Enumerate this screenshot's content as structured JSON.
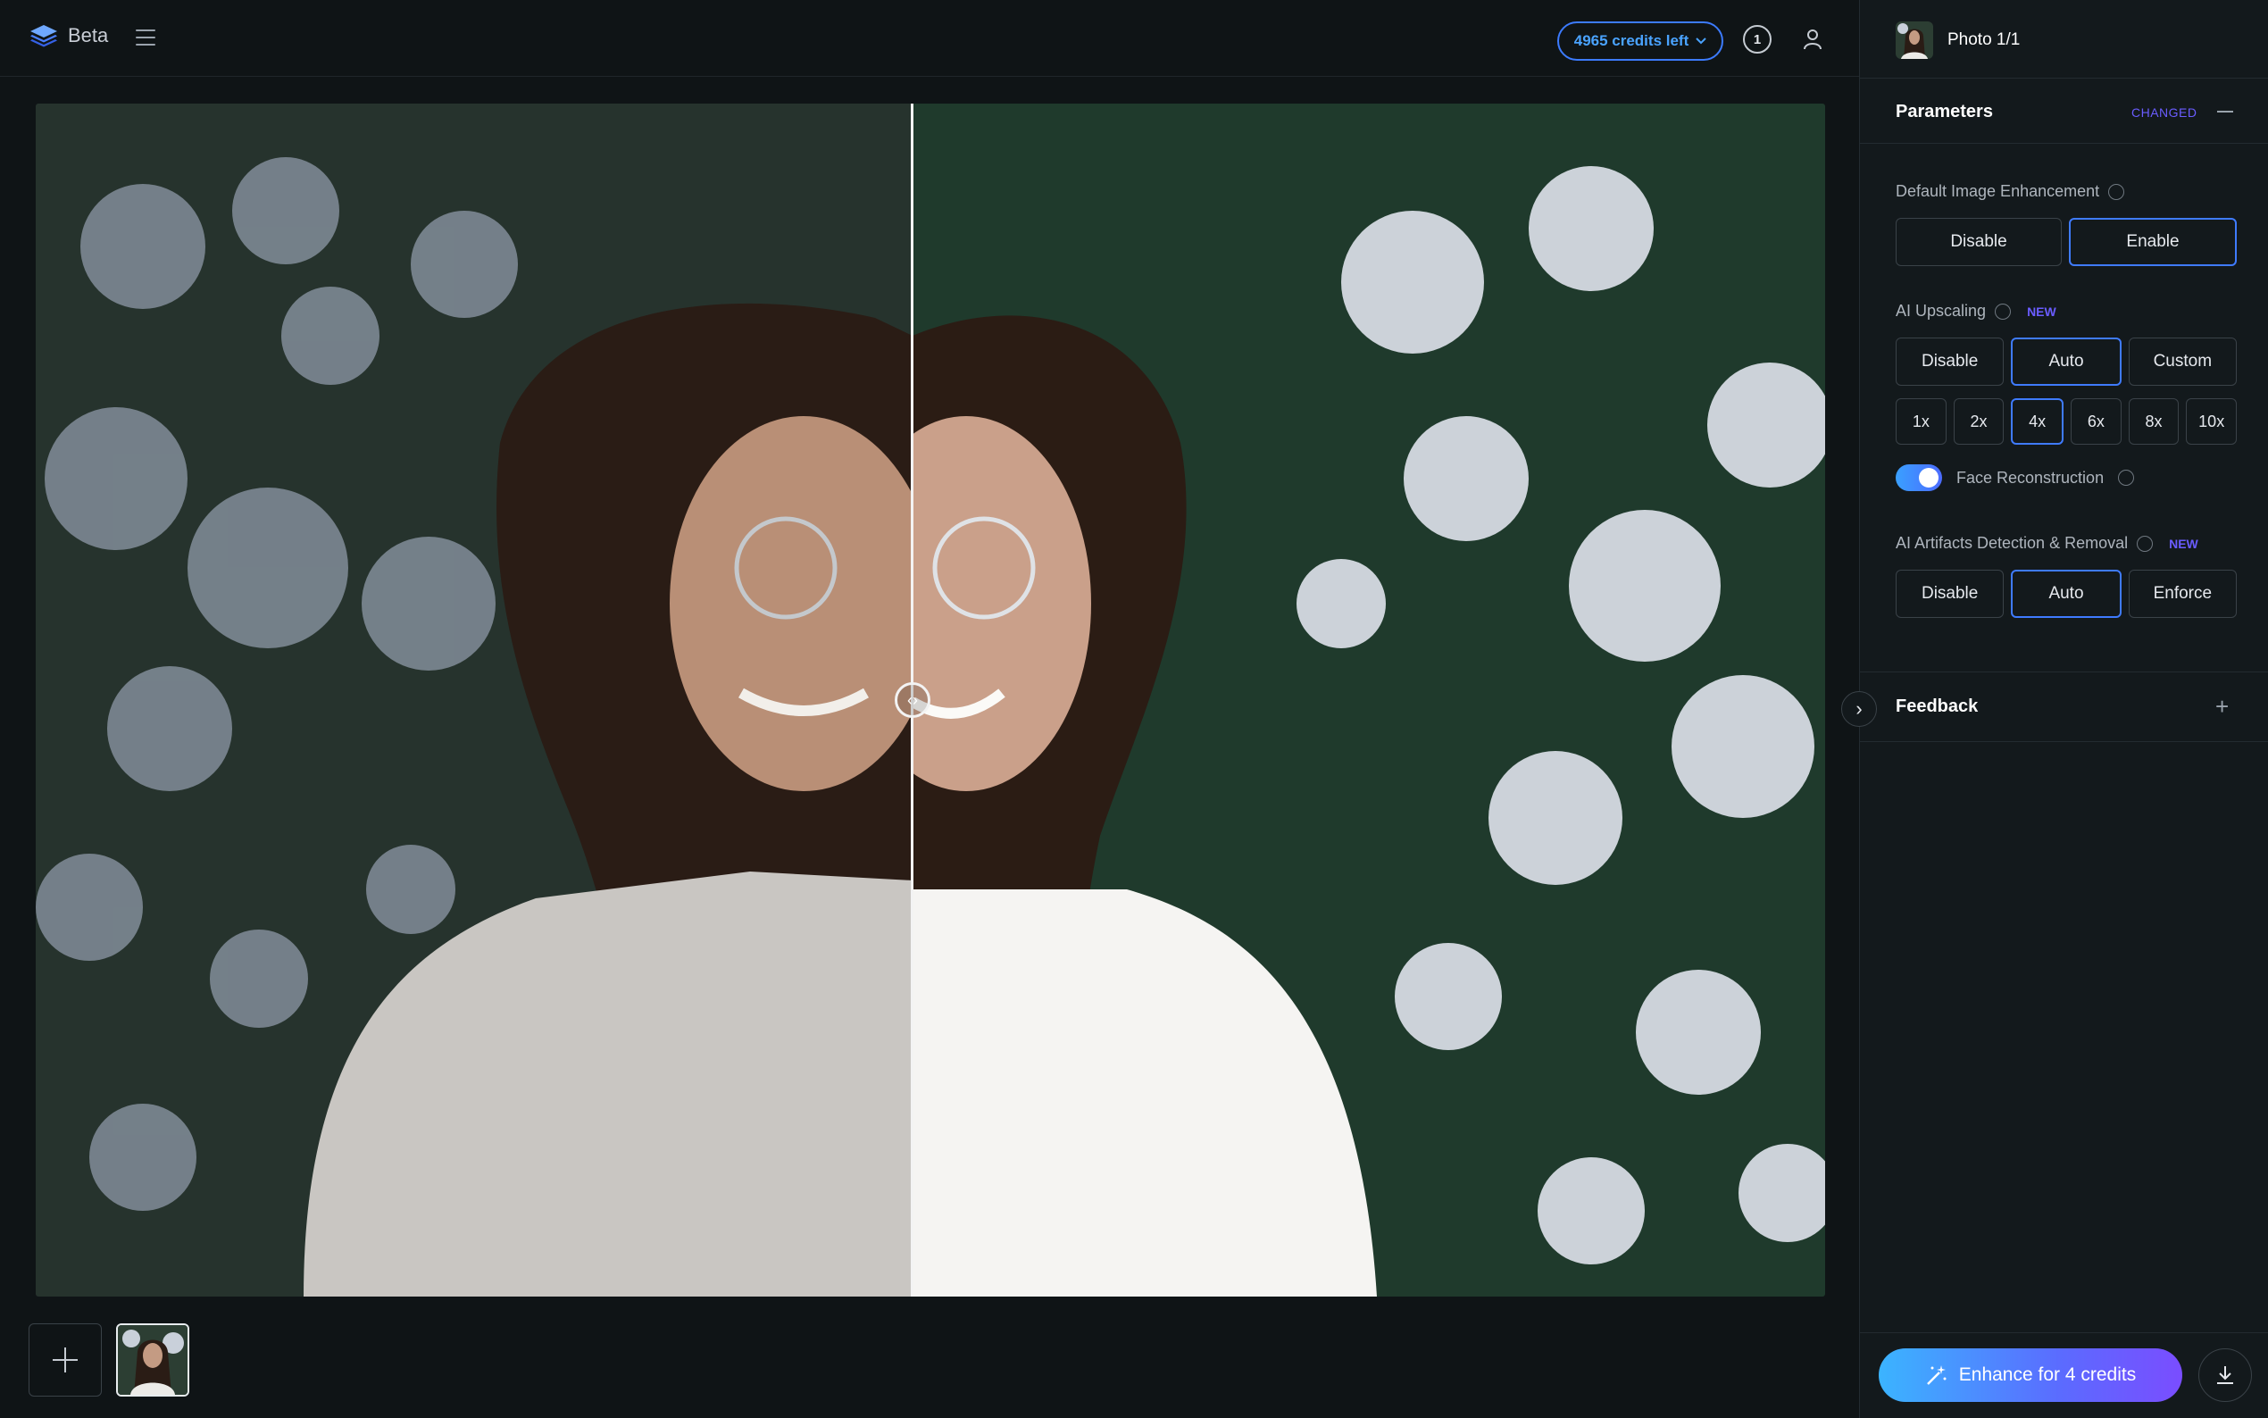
{
  "app": {
    "brand": "Beta"
  },
  "header": {
    "credits_label": "4965 credits left",
    "badge_count": "1"
  },
  "panel": {
    "photo_label": "Photo 1/1",
    "parameters_title": "Parameters",
    "changed_label": "CHANGED",
    "enhancement": {
      "label": "Default Image Enhancement",
      "options": [
        "Disable",
        "Enable"
      ],
      "selected": "Enable"
    },
    "upscaling": {
      "label": "AI Upscaling",
      "new_tag": "NEW",
      "modes": [
        "Disable",
        "Auto",
        "Custom"
      ],
      "selected_mode": "Auto",
      "factors": [
        "1x",
        "2x",
        "4x",
        "6x",
        "8x",
        "10x"
      ],
      "selected_factor": "4x"
    },
    "face_reconstruction": {
      "label": "Face Reconstruction",
      "enabled": true
    },
    "artifacts": {
      "label": "AI Artifacts Detection & Removal",
      "new_tag": "NEW",
      "options": [
        "Disable",
        "Auto",
        "Enforce"
      ],
      "selected": "Auto"
    },
    "feedback_title": "Feedback",
    "enhance_button": "Enhance for 4 credits"
  },
  "colors": {
    "accent": "#3f7bff",
    "new_tag": "#6a5cff",
    "credits": "#4aa3ff"
  },
  "icons": [
    "stack-logo-icon",
    "hamburger-menu-icon",
    "chevron-down-icon",
    "notification-icon",
    "user-icon",
    "info-icon",
    "plus-icon",
    "chevron-right-icon",
    "magic-wand-icon",
    "download-icon",
    "compare-handle-icon"
  ]
}
